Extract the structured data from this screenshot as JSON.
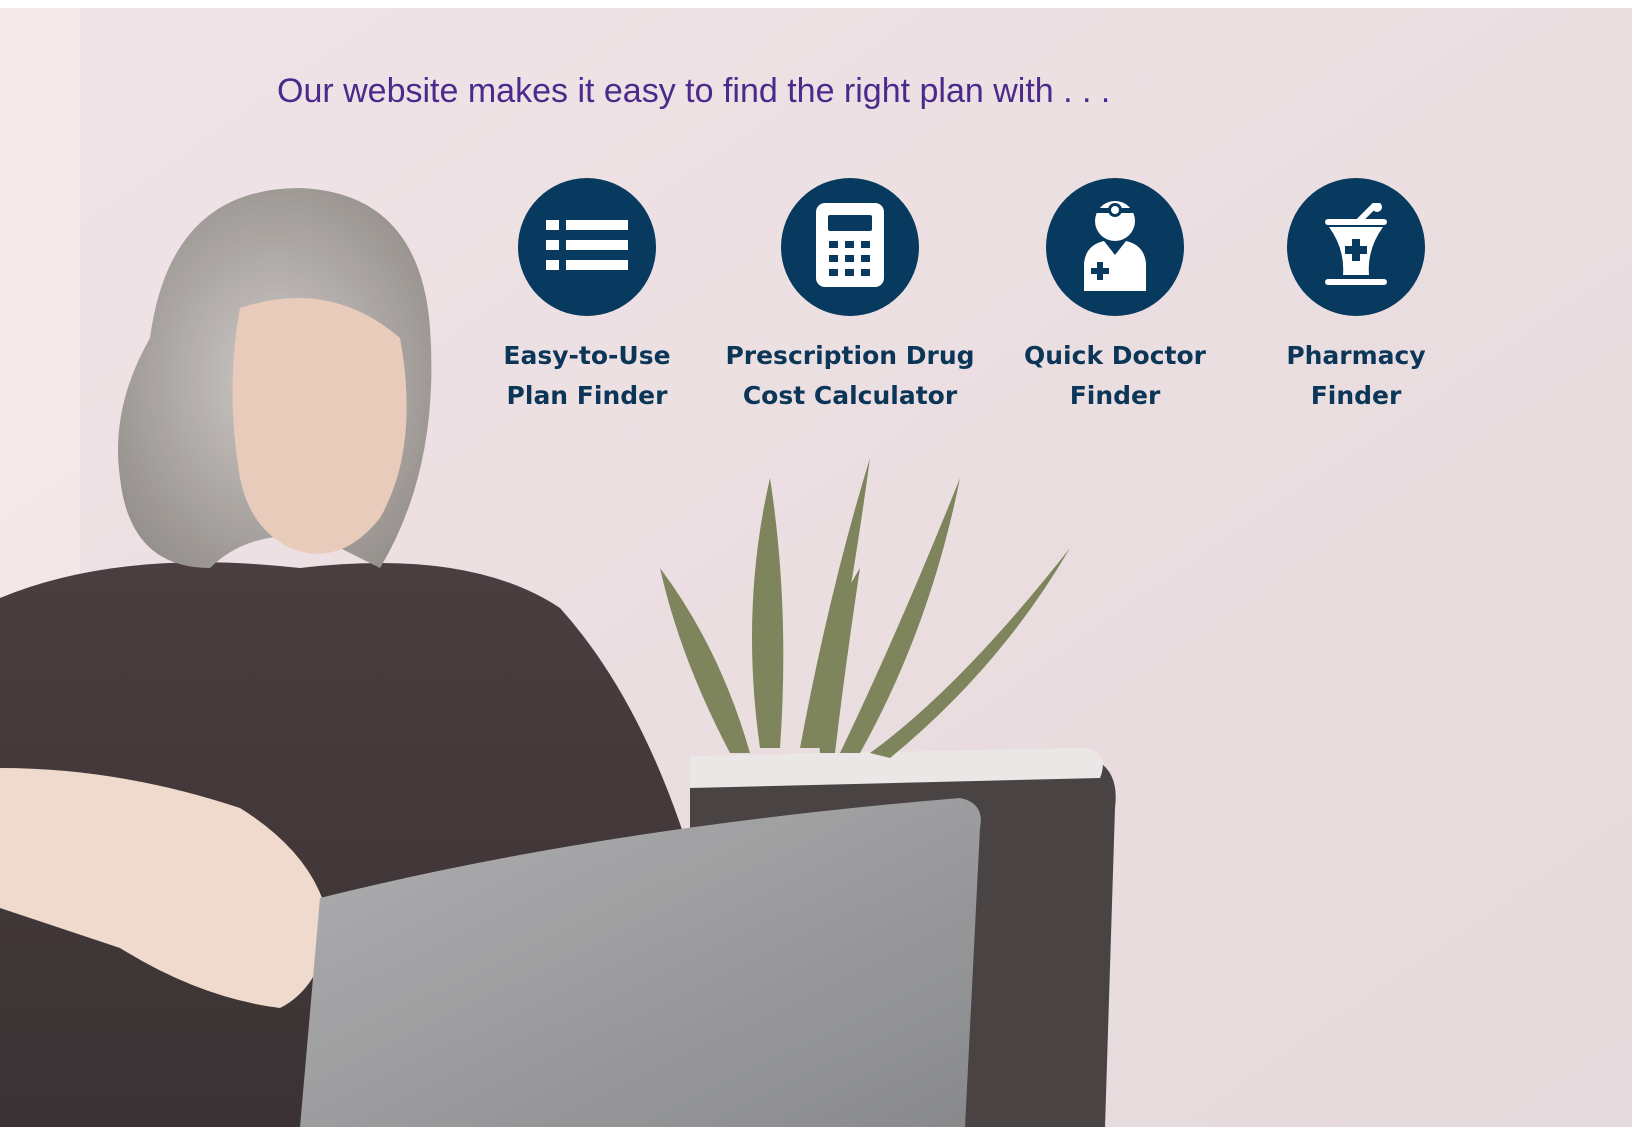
{
  "headline": "Our website makes it easy to find the right plan with . . .",
  "features": [
    {
      "icon": "list-icon",
      "line1": "Easy-to-Use",
      "line2": "Plan Finder"
    },
    {
      "icon": "calculator-icon",
      "line1": "Prescription Drug",
      "line2": "Cost Calculator"
    },
    {
      "icon": "doctor-icon",
      "line1": "Quick Doctor",
      "line2": "Finder"
    },
    {
      "icon": "mortar-pestle-icon",
      "line1": "Pharmacy",
      "line2": "Finder"
    }
  ],
  "colors": {
    "headline": "#4b2a8c",
    "icon_circle": "#073a5e",
    "label": "#0c3658"
  }
}
